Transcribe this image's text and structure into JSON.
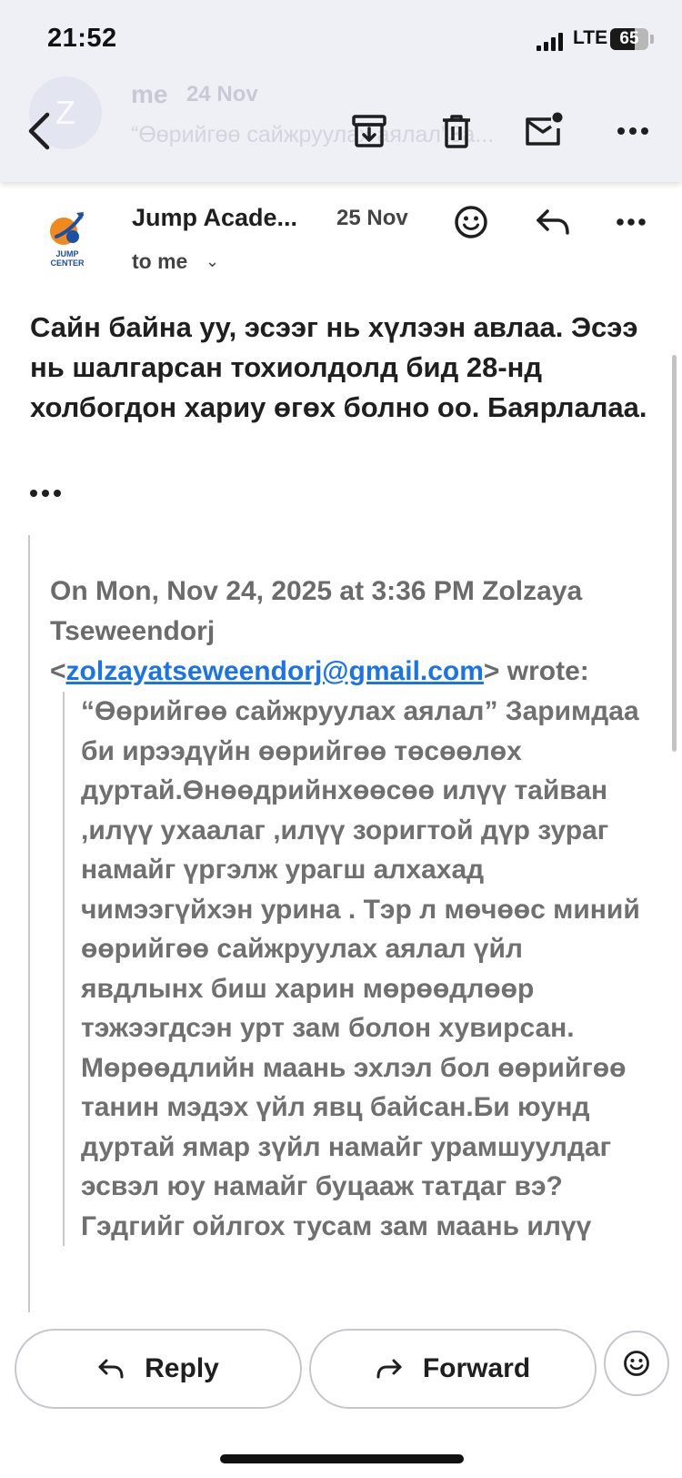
{
  "status_bar": {
    "time": "21:52",
    "network": "LTE",
    "battery": "65",
    "battery_level": 0.65
  },
  "previous_message": {
    "avatar_letter": "Z",
    "sender": "me",
    "date": "24 Nov",
    "snippet": "“Өөрийгөө сайжруулах аялал”За..."
  },
  "toolbar": {
    "back_icon": "chevron-left-icon",
    "archive_icon": "archive-icon",
    "delete_icon": "trash-icon",
    "mark_unread_icon": "mail-unread-icon",
    "more_icon": "more-horizontal-icon"
  },
  "message": {
    "logo_text": "JUMP CENTER",
    "sender": "Jump Acade...",
    "date": "25 Nov",
    "recipient": "to me",
    "body": "Сайн байна уу, эсээг нь хүлээн авлаа. Эсээ нь шалгарсан тохиолдолд бид 28-нд холбогдон хариу өгөх болно оо. Баярлалаа.",
    "quote_header_prefix": "On Mon, Nov 24, 2025 at 3:36 PM Zolzaya Tseweendorj <",
    "quote_email": "zolzayatseweendorj@gmail.com",
    "quote_header_suffix": "> wrote:",
    "quoted_text": "“Өөрийгөө сайжруулах аялал” Заримдаа би ирээдүйн өөрийгөө төсөөлөх дуртай.Өнөөдрийнхөөсөө илүү тайван ,илүү ухаалаг ,илүү зоригтой дүр зураг намайг үргэлж урагш алхахад чимээгүйхэн урина . Тэр л мөчөөс миний өөрийгөө сайжруулах аялал үйл явдлынх биш харин мөрөөдлөөр тэжээгдсэн урт зам болон хувирсан. Мөрөөдлийн маань эхлэл бол өөрийгөө танин мэдэх үйл явц байсан.Би юунд дуртай ямар зүйл намайг урамшуулдаг эсвэл юу намайг буцааж татдаг вэ? Гэдгийг ойлгох тусам зам маань илүү"
  },
  "actions": {
    "reply": "Reply",
    "forward": "Forward"
  },
  "colors": {
    "link": "#1a73e8",
    "toolbar_bg": "#eef0f6",
    "logo_orange": "#f08a1c",
    "logo_blue": "#1d4fa3"
  }
}
